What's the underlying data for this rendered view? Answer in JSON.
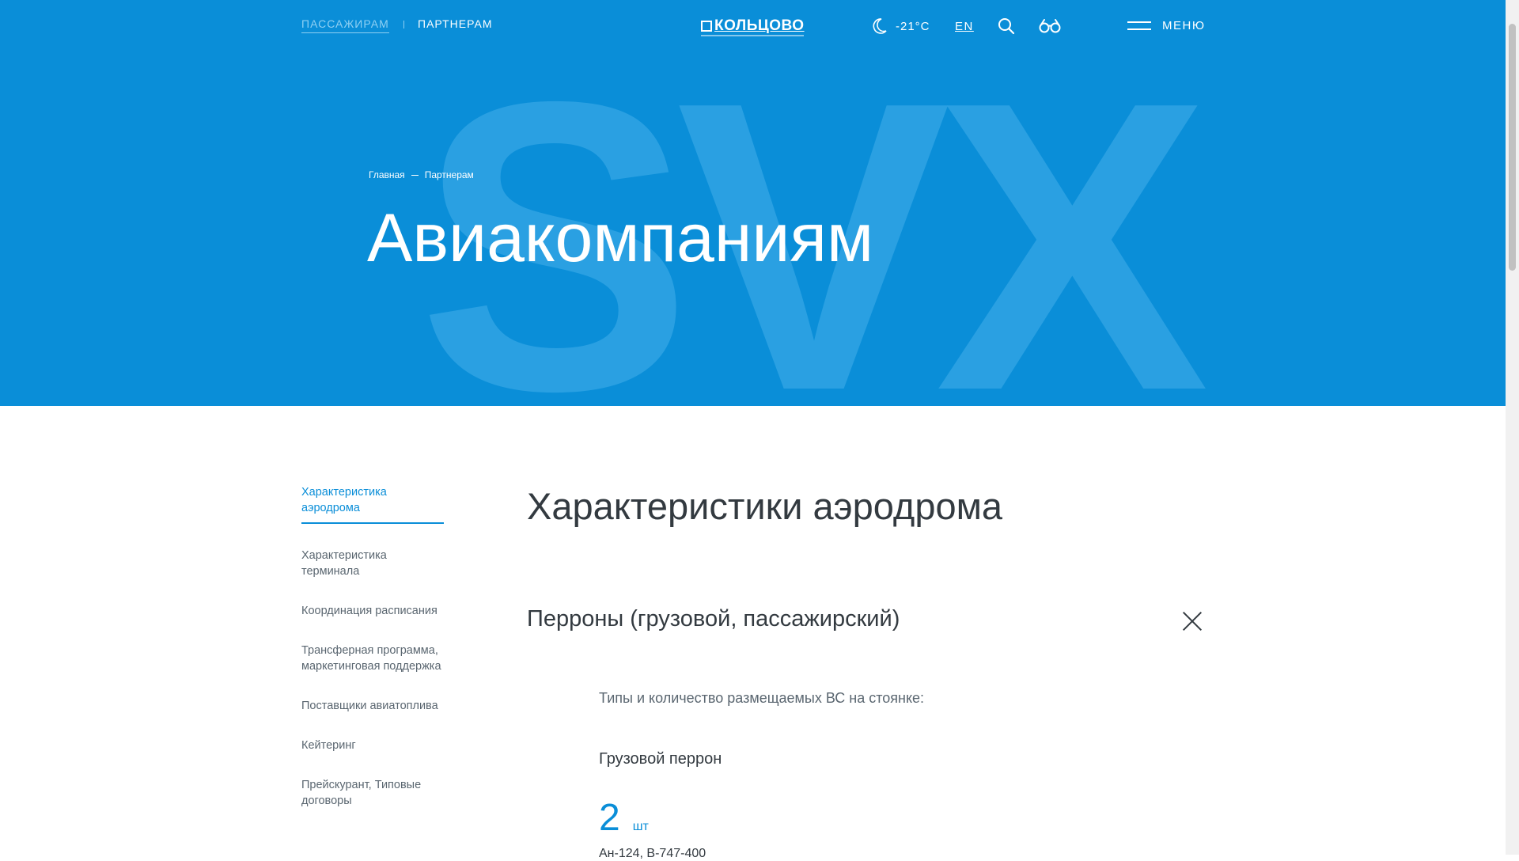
{
  "header": {
    "nav": {
      "passengers": "ПАССАЖИРАМ",
      "partners": "ПАРТНЕРАМ"
    },
    "logo_text": "КОЛЬЦОВО",
    "weather": {
      "temperature": "-21°C",
      "icon": "moon-icon"
    },
    "language": "EN",
    "menu_label": "МЕНЮ"
  },
  "hero": {
    "watermark": "SVX",
    "breadcrumb": {
      "home": "Главная",
      "current": "Партнерам"
    },
    "title": "Авиакомпаниям"
  },
  "sidebar": {
    "items": [
      {
        "label": "Характеристика аэродрома",
        "active": true
      },
      {
        "label": "Характеристика терминала",
        "active": false
      },
      {
        "label": "Координация расписания",
        "active": false
      },
      {
        "label": "Трансферная программа, маркетинговая поддержка",
        "active": false
      },
      {
        "label": "Поставщики авиатоплива",
        "active": false
      },
      {
        "label": "Кейтеринг",
        "active": false
      },
      {
        "label": "Прейскурант, Типовые договоры",
        "active": false
      }
    ]
  },
  "main": {
    "section_title": "Характеристики аэродрома",
    "accordion_title": "Перроны (грузовой, пассажирский)",
    "types_text": "Типы и количество размещаемых ВС на стоянке:",
    "cargo_title": "Грузовой перрон",
    "count": {
      "value": "2",
      "unit": "шт"
    },
    "aircraft_types": "Ан-124, B-747-400"
  },
  "colors": {
    "brand": "#0a8ed8",
    "text": "#333a40",
    "muted": "#5a6670"
  }
}
